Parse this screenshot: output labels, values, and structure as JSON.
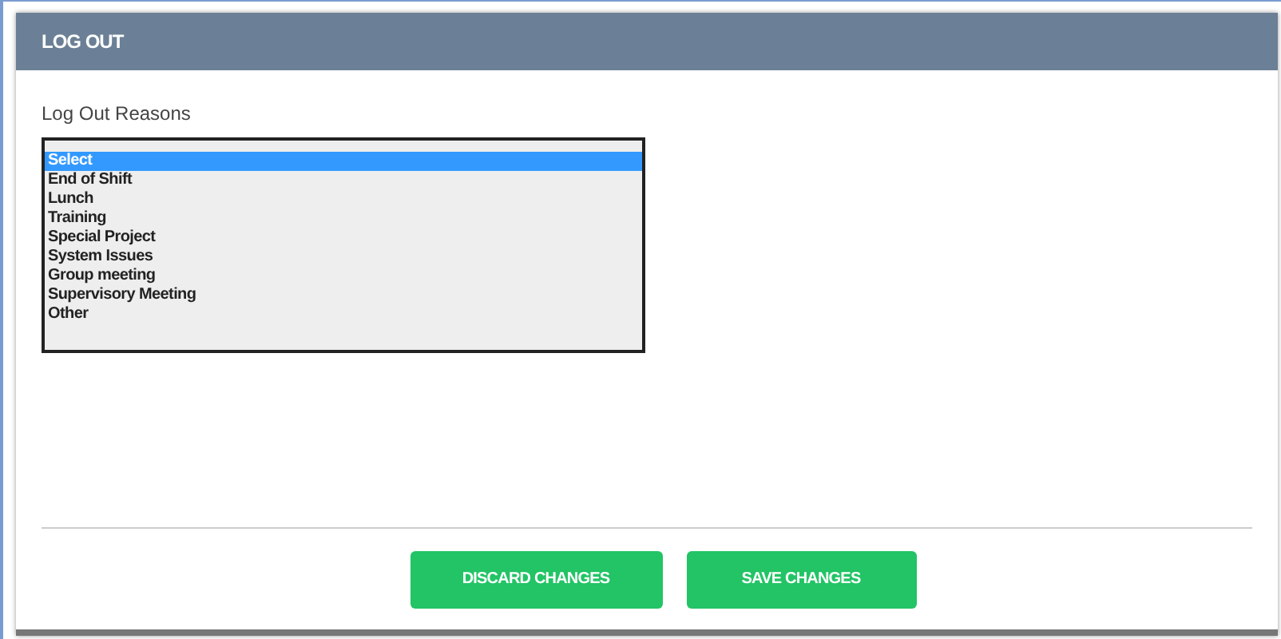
{
  "dialog": {
    "title": "LOG OUT"
  },
  "field": {
    "label": "Log Out Reasons",
    "options": [
      {
        "label": "Select",
        "selected": true
      },
      {
        "label": "End of Shift",
        "selected": false
      },
      {
        "label": "Lunch",
        "selected": false
      },
      {
        "label": "Training",
        "selected": false
      },
      {
        "label": "Special Project",
        "selected": false
      },
      {
        "label": "System Issues",
        "selected": false
      },
      {
        "label": "Group meeting",
        "selected": false
      },
      {
        "label": "Supervisory Meeting",
        "selected": false
      },
      {
        "label": "Other",
        "selected": false
      }
    ]
  },
  "buttons": [
    "DISCARD CHANGES",
    "SAVE CHANGES"
  ]
}
